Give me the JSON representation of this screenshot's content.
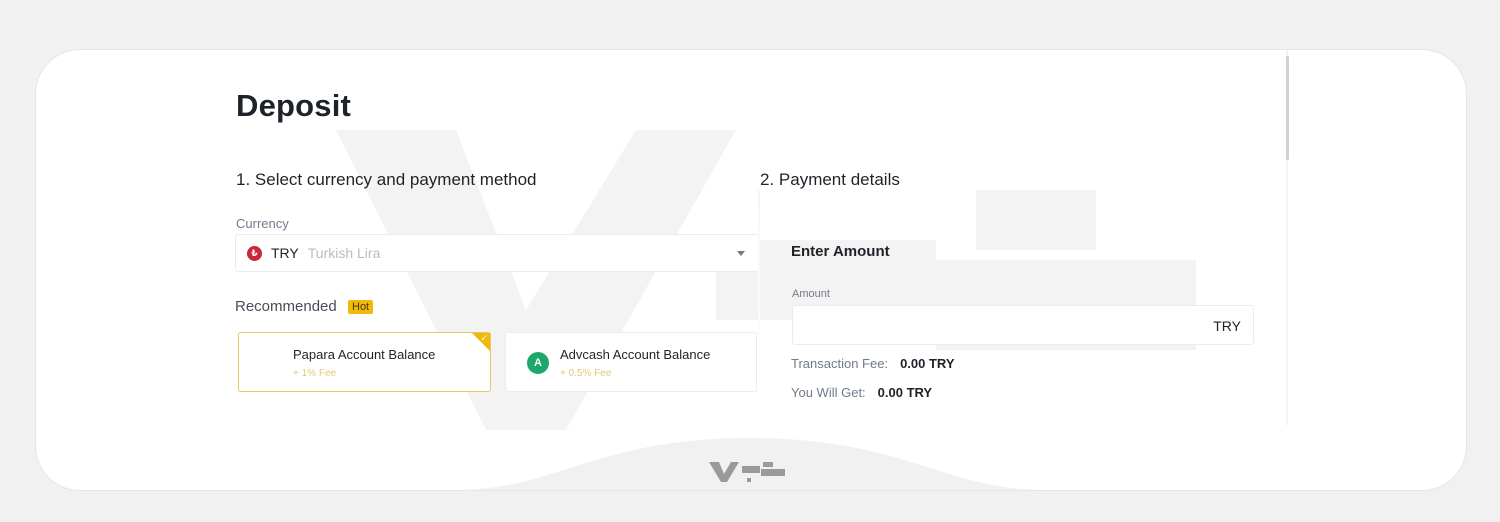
{
  "page": {
    "title": "Deposit"
  },
  "step1": {
    "title": "1. Select currency and payment method",
    "currency_label": "Currency",
    "currency": {
      "code": "TRY",
      "name": "Turkish Lira",
      "icon": "turkish-lira-flag-icon"
    },
    "recommended_label": "Recommended",
    "hot_badge": "Hot",
    "methods": [
      {
        "name": "Papara Account Balance",
        "fee": "+ 1% Fee",
        "selected": true
      },
      {
        "name": "Advcash Account Balance",
        "fee": "+ 0.5% Fee",
        "selected": false,
        "icon": "advcash-logo-icon"
      }
    ]
  },
  "step2": {
    "title": "2. Payment details",
    "enter_amount": "Enter Amount",
    "amount_label": "Amount",
    "amount_value": "",
    "amount_unit": "TRY",
    "transaction_fee_label": "Transaction Fee:",
    "transaction_fee_value": "0.00 TRY",
    "you_will_get_label": "You Will Get:",
    "you_will_get_value": "0.00 TRY"
  },
  "colors": {
    "accent": "#f0b90b",
    "text": "#1e2329",
    "muted": "#707a8a",
    "border": "#eaecef",
    "try_red": "#c9283c",
    "advcash_green": "#1ea76a"
  }
}
